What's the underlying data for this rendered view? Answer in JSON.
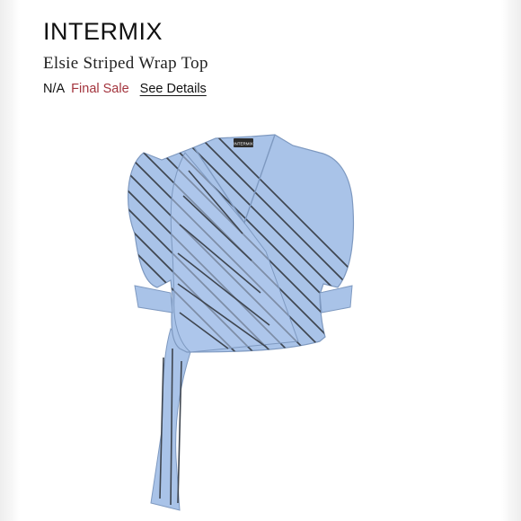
{
  "product": {
    "brand": "INTERMIX",
    "title": "Elsie Striped Wrap Top",
    "price": "N/A",
    "sale_status": "Final Sale",
    "details_link": "See Details"
  },
  "garment_label": "INTERMIX",
  "colors": {
    "sale_red": "#a3343d",
    "fabric_blue": "#a9c3e8",
    "stripe_dark": "#3f4650"
  }
}
